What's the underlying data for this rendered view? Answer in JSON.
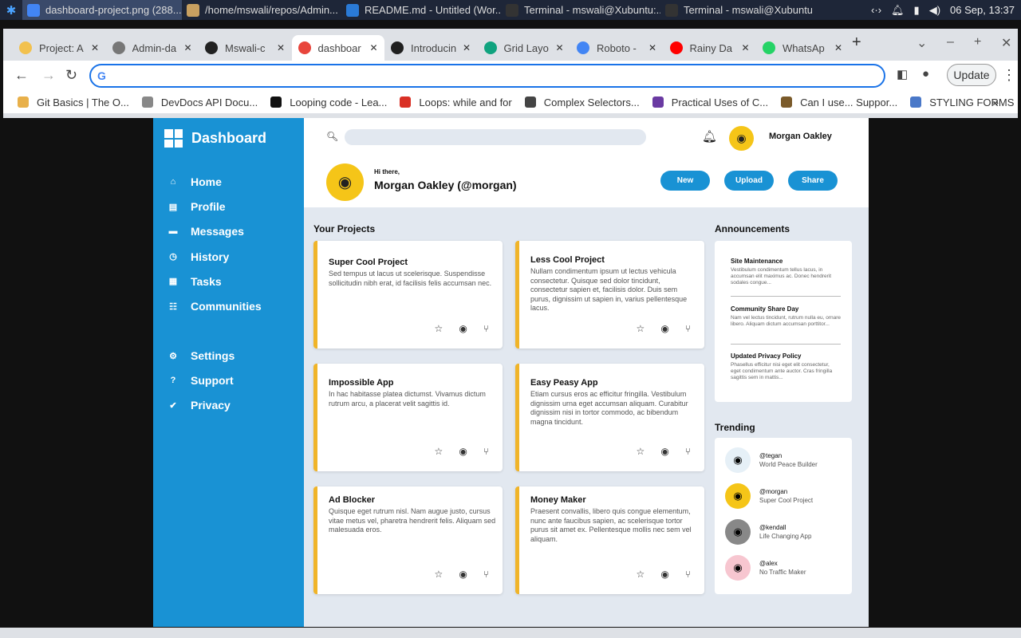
{
  "taskbar": {
    "items": [
      {
        "label": "dashboard-project.png (288..."
      },
      {
        "label": "/home/mswali/repos/Admin..."
      },
      {
        "label": "README.md - Untitled (Wor..."
      },
      {
        "label": "Terminal - mswali@Xubuntu:..."
      },
      {
        "label": "Terminal - mswali@Xubuntu:..."
      }
    ],
    "clock": "06 Sep, 13:37"
  },
  "browser": {
    "tabs": [
      {
        "label": "Project: A",
        "color": "#f2c14e"
      },
      {
        "label": "Admin-da",
        "color": "#777777"
      },
      {
        "label": "Mswali-c",
        "color": "#222222"
      },
      {
        "label": "dashboar",
        "color": "#e8453c"
      },
      {
        "label": "Introducin",
        "color": "#202020"
      },
      {
        "label": "Grid Layo",
        "color": "#10a37f"
      },
      {
        "label": "Roboto -",
        "color": "#4285f4"
      },
      {
        "label": "Rainy Da",
        "color": "#ff0000"
      },
      {
        "label": "WhatsAp",
        "color": "#25d366"
      }
    ],
    "address_value": "",
    "update_label": "Update",
    "bookmarks": [
      {
        "label": "Git Basics | The O...",
        "color": "#e8b04a"
      },
      {
        "label": "DevDocs API Docu...",
        "color": "#888888"
      },
      {
        "label": "Looping code - Lea...",
        "color": "#111111"
      },
      {
        "label": "Loops: while and for",
        "color": "#d93025"
      },
      {
        "label": "Complex Selectors...",
        "color": "#444444"
      },
      {
        "label": "Practical Uses of C...",
        "color": "#6a3aa2"
      },
      {
        "label": "Can I use... Suppor...",
        "color": "#7a5a2a"
      },
      {
        "label": "STYLING FORMS",
        "color": "#4a78c8"
      }
    ]
  },
  "sidebar": {
    "title": "Dashboard",
    "nav": [
      {
        "label": "Home",
        "icon": "home-icon",
        "glyph": "⌂"
      },
      {
        "label": "Profile",
        "icon": "profile-icon",
        "glyph": "▤"
      },
      {
        "label": "Messages",
        "icon": "messages-icon",
        "glyph": "▬"
      },
      {
        "label": "History",
        "icon": "history-icon",
        "glyph": "◷"
      },
      {
        "label": "Tasks",
        "icon": "tasks-icon",
        "glyph": "▦"
      },
      {
        "label": "Communities",
        "icon": "communities-icon",
        "glyph": "☷"
      }
    ],
    "nav2": [
      {
        "label": "Settings",
        "icon": "settings-icon",
        "glyph": "⚙"
      },
      {
        "label": "Support",
        "icon": "support-icon",
        "glyph": "?"
      },
      {
        "label": "Privacy",
        "icon": "shield-icon",
        "glyph": "✔"
      }
    ],
    "accent": "#1992d4"
  },
  "header": {
    "search_placeholder": "",
    "username": "Morgan Oakley",
    "greeting": "Hi there,",
    "display_name": "Morgan Oakley (@morgan)",
    "buttons": {
      "new": "New",
      "upload": "Upload",
      "share": "Share"
    }
  },
  "projects": {
    "title": "Your Projects",
    "items": [
      {
        "title": "Super Cool Project",
        "body": "Sed tempus ut lacus ut scelerisque. Suspendisse sollicitudin nibh erat, id facilisis felis accumsan nec."
      },
      {
        "title": "Less Cool Project",
        "body": "Nullam condimentum ipsum ut lectus vehicula consectetur. Quisque sed dolor tincidunt, consectetur sapien et, facilisis dolor. Duis sem purus, dignissim ut sapien in, varius pellentesque lacus."
      },
      {
        "title": "Impossible App",
        "body": "In hac habitasse platea dictumst. Vivamus dictum rutrum arcu, a placerat velit sagittis id."
      },
      {
        "title": "Easy Peasy App",
        "body": "Etiam cursus eros ac efficitur fringilla. Vestibulum dignissim urna eget accumsan aliquam. Curabitur dignissim nisi in tortor commodo, ac bibendum magna tincidunt."
      },
      {
        "title": "Ad Blocker",
        "body": "Quisque eget rutrum nisl. Nam augue justo, cursus vitae metus vel, pharetra hendrerit felis. Aliquam sed malesuada eros."
      },
      {
        "title": "Money Maker",
        "body": "Praesent convallis, libero quis congue elementum, nunc ante faucibus sapien, ac scelerisque tortor purus sit amet ex. Pellentesque mollis nec sem vel aliquam."
      }
    ],
    "card_accent": "#f0b429"
  },
  "announcements": {
    "title": "Announcements",
    "items": [
      {
        "title": "Site Maintenance",
        "body": "Vestibulum condimentum tellus lacus, in accumsan elit maximus ac. Donec hendrerit sodales congue..."
      },
      {
        "title": "Community Share Day",
        "body": "Nam vel lectus tincidunt, rutrum nulla eu, ornare libero. Aliquam dictum accumsan porttitor..."
      },
      {
        "title": "Updated Privacy Policy",
        "body": "Phasellus efficitur nisi eget elit consectetur, eget condimentum ante auctor. Cras fringilla sagittis sem in mattis..."
      }
    ]
  },
  "trending": {
    "title": "Trending",
    "items": [
      {
        "handle": "@tegan",
        "project": "World Peace Builder",
        "color": "#e6f0f7"
      },
      {
        "handle": "@morgan",
        "project": "Super Cool Project",
        "color": "#f5c518"
      },
      {
        "handle": "@kendall",
        "project": "Life Changing App",
        "color": "#888888"
      },
      {
        "handle": "@alex",
        "project": "No Traffic Maker",
        "color": "#f7c6d0"
      }
    ]
  }
}
